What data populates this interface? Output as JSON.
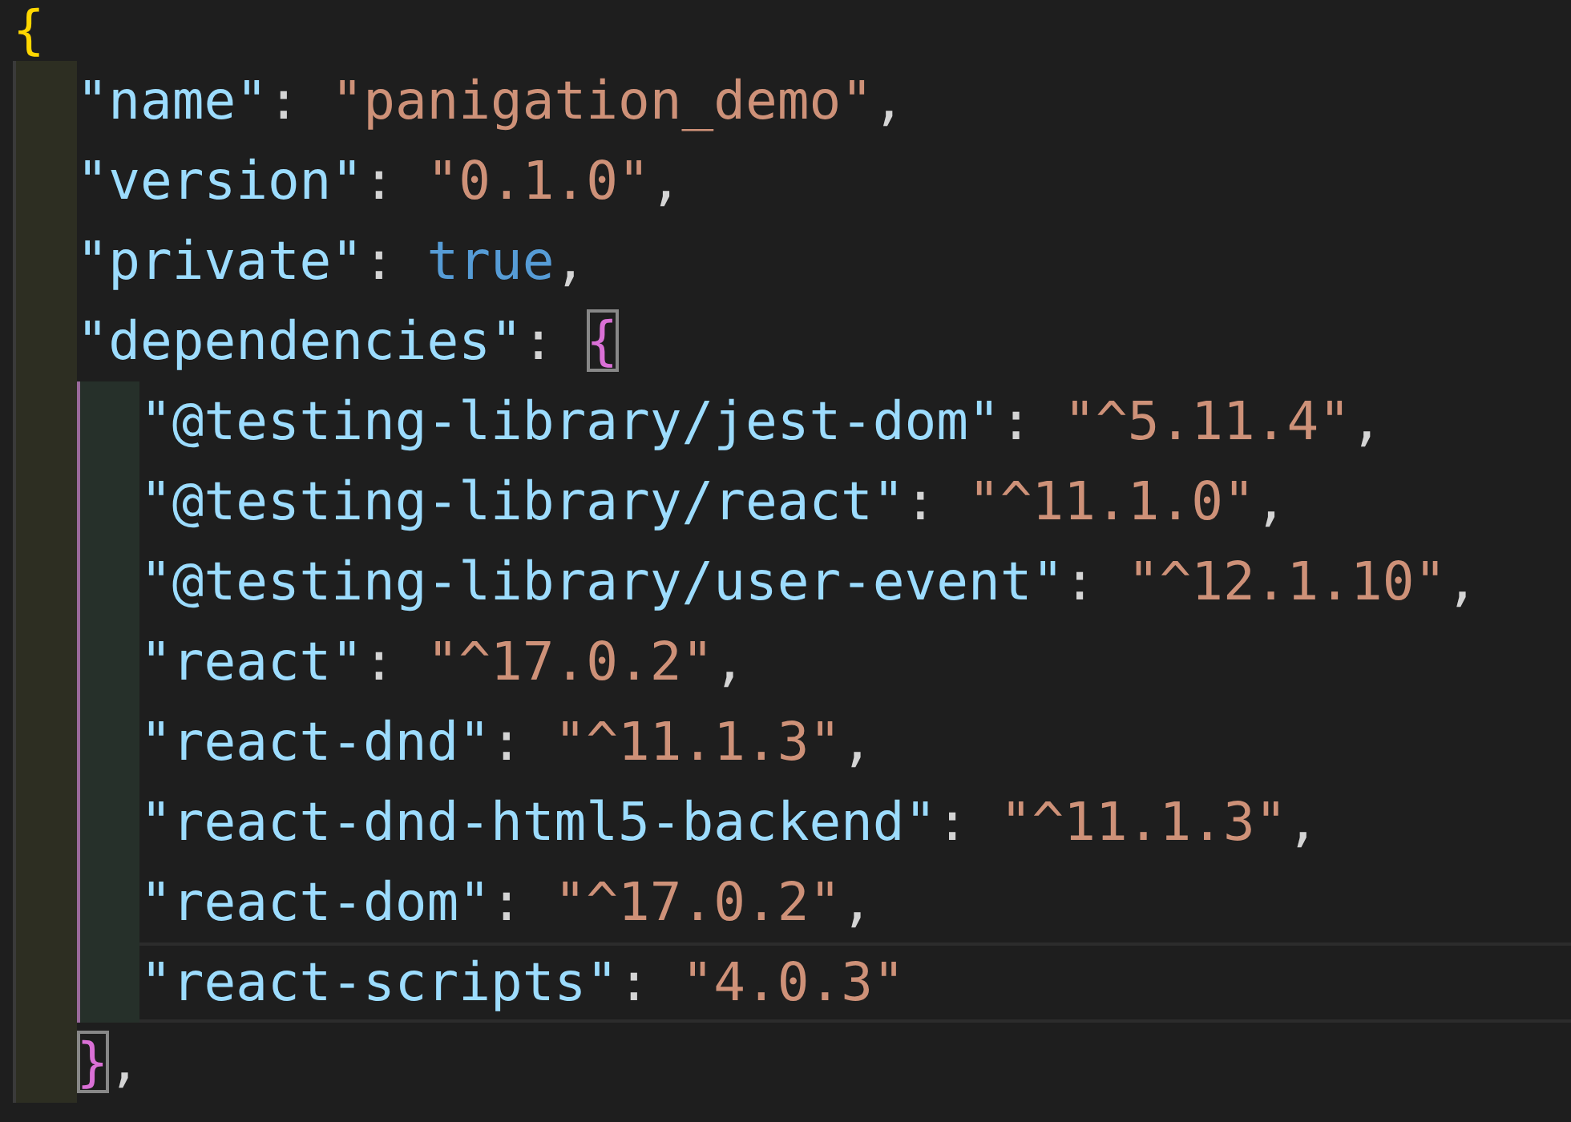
{
  "editor": {
    "lines": [
      {
        "current": false,
        "tokens": [
          {
            "kind": "bracket",
            "text": "{",
            "highlighted": false
          }
        ],
        "children": [
          {
            "current": false,
            "tokens": [
              {
                "kind": "key",
                "text": "\"name\""
              },
              {
                "kind": "punct",
                "text": ": "
              },
              {
                "kind": "string",
                "text": "\"panigation_demo\""
              },
              {
                "kind": "punct",
                "text": ","
              }
            ]
          },
          {
            "current": false,
            "tokens": [
              {
                "kind": "key",
                "text": "\"version\""
              },
              {
                "kind": "punct",
                "text": ": "
              },
              {
                "kind": "string",
                "text": "\"0.1.0\""
              },
              {
                "kind": "punct",
                "text": ","
              }
            ]
          },
          {
            "current": false,
            "tokens": [
              {
                "kind": "key",
                "text": "\"private\""
              },
              {
                "kind": "punct",
                "text": ": "
              },
              {
                "kind": "keyword",
                "text": "true"
              },
              {
                "kind": "punct",
                "text": ","
              }
            ]
          },
          {
            "current": false,
            "tokens": [
              {
                "kind": "key",
                "text": "\"dependencies\""
              },
              {
                "kind": "punct",
                "text": ": "
              },
              {
                "kind": "bracket",
                "text": "{",
                "highlighted": true
              }
            ],
            "children": [
              {
                "current": false,
                "tokens": [
                  {
                    "kind": "key",
                    "text": "\"@testing-library/jest-dom\""
                  },
                  {
                    "kind": "punct",
                    "text": ": "
                  },
                  {
                    "kind": "string",
                    "text": "\"^5.11.4\""
                  },
                  {
                    "kind": "punct",
                    "text": ","
                  }
                ]
              },
              {
                "current": false,
                "tokens": [
                  {
                    "kind": "key",
                    "text": "\"@testing-library/react\""
                  },
                  {
                    "kind": "punct",
                    "text": ": "
                  },
                  {
                    "kind": "string",
                    "text": "\"^11.1.0\""
                  },
                  {
                    "kind": "punct",
                    "text": ","
                  }
                ]
              },
              {
                "current": false,
                "tokens": [
                  {
                    "kind": "key",
                    "text": "\"@testing-library/user-event\""
                  },
                  {
                    "kind": "punct",
                    "text": ": "
                  },
                  {
                    "kind": "string",
                    "text": "\"^12.1.10\""
                  },
                  {
                    "kind": "punct",
                    "text": ","
                  }
                ]
              },
              {
                "current": false,
                "tokens": [
                  {
                    "kind": "key",
                    "text": "\"react\""
                  },
                  {
                    "kind": "punct",
                    "text": ": "
                  },
                  {
                    "kind": "string",
                    "text": "\"^17.0.2\""
                  },
                  {
                    "kind": "punct",
                    "text": ","
                  }
                ]
              },
              {
                "current": false,
                "tokens": [
                  {
                    "kind": "key",
                    "text": "\"react-dnd\""
                  },
                  {
                    "kind": "punct",
                    "text": ": "
                  },
                  {
                    "kind": "string",
                    "text": "\"^11.1.3\""
                  },
                  {
                    "kind": "punct",
                    "text": ","
                  }
                ]
              },
              {
                "current": false,
                "tokens": [
                  {
                    "kind": "key",
                    "text": "\"react-dnd-html5-backend\""
                  },
                  {
                    "kind": "punct",
                    "text": ": "
                  },
                  {
                    "kind": "string",
                    "text": "\"^11.1.3\""
                  },
                  {
                    "kind": "punct",
                    "text": ","
                  }
                ]
              },
              {
                "current": false,
                "tokens": [
                  {
                    "kind": "key",
                    "text": "\"react-dom\""
                  },
                  {
                    "kind": "punct",
                    "text": ": "
                  },
                  {
                    "kind": "string",
                    "text": "\"^17.0.2\""
                  },
                  {
                    "kind": "punct",
                    "text": ","
                  }
                ]
              },
              {
                "current": true,
                "tokens": [
                  {
                    "kind": "key",
                    "text": "\"react-scripts\""
                  },
                  {
                    "kind": "punct",
                    "text": ": "
                  },
                  {
                    "kind": "string",
                    "text": "\"4.0.3\""
                  }
                ]
              }
            ]
          },
          {
            "current": false,
            "tokens": [
              {
                "kind": "bracket",
                "text": "}",
                "highlighted": true
              },
              {
                "kind": "punct",
                "text": ","
              }
            ]
          }
        ]
      }
    ]
  }
}
